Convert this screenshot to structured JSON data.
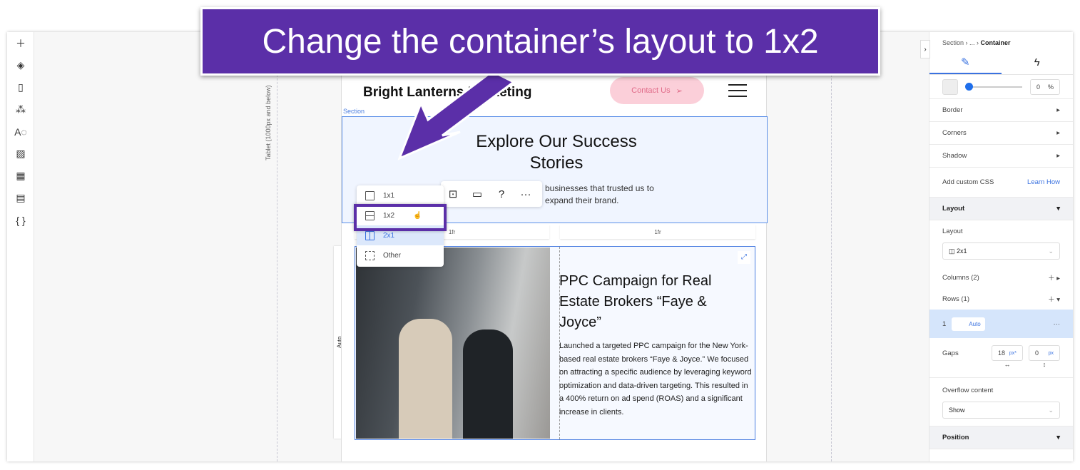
{
  "callout": "Change the container’s layout to 1x2",
  "left_toolbar": [
    "plus-icon",
    "layers-icon",
    "pages-icon",
    "apps-icon",
    "theme-icon",
    "media-icon",
    "grid-icon",
    "table-icon",
    "code-icon"
  ],
  "breakpoint_label": "Tablet (1000px and below)",
  "site": {
    "brand": "Bright Lanterns Marketing",
    "contact": "Contact Us",
    "section_label": "Section",
    "heading": "Explore Our Success Stories",
    "subtext": "businesses that trusted us to expand their brand.",
    "columns": [
      "1fr",
      "1fr"
    ],
    "row_label": "Auto",
    "card_title": "PPC Campaign for Real Estate Brokers “Faye & Joyce”",
    "card_body": "Launched a targeted PPC campaign for the New York-based real estate brokers “Faye & Joyce.” We focused on attracting a specific audience by leveraging keyword optimization and data-driven targeting. This resulted in a 400% return on ad spend (ROAS) and a significant increase in clients."
  },
  "layout_menu": [
    {
      "label": "1x1"
    },
    {
      "label": "1x2",
      "hovered": true
    },
    {
      "label": "2x1",
      "selected": true
    },
    {
      "label": "Other"
    }
  ],
  "toolbar_icons": [
    "fit-icon",
    "comment-icon",
    "help-icon",
    "more-icon"
  ],
  "panel": {
    "breadcrumb": {
      "a": "Section",
      "b": "...",
      "c": "Container"
    },
    "opacity": "0",
    "opacity_unit": "%",
    "border": "Border",
    "corners": "Corners",
    "shadow": "Shadow",
    "css": "Add custom CSS",
    "learn": "Learn How",
    "layout_section": "Layout",
    "layout_label": "Layout",
    "layout_value": "2x1",
    "columns": "Columns (2)",
    "rows": "Rows (1)",
    "row_index": "1",
    "row_value": "Auto",
    "row_more": "···",
    "gaps": "Gaps",
    "gap_h": "18",
    "gap_h_unit": "px*",
    "gap_v": "0",
    "gap_v_unit": "px",
    "overflow": "Overflow content",
    "overflow_value": "Show",
    "position": "Position"
  },
  "accent": "#3a72e0",
  "callout_color": "#5b2fa8"
}
